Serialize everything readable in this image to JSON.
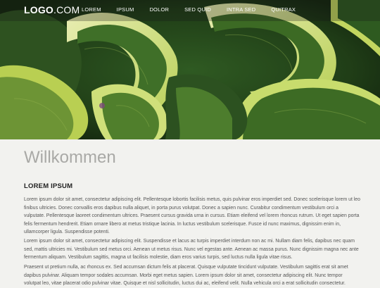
{
  "header": {
    "logo_bold": "LOGO",
    "logo_light": ".COM",
    "nav": [
      "LOREM",
      "IPSUM",
      "DOLOR",
      "SED QUID",
      "INTRA SED",
      "QUITRAX"
    ]
  },
  "colors": {
    "page_background": "#f2f2ef",
    "heading_color": "#a9a9a6",
    "leaf_dark": "#28461d",
    "leaf_light": "#cddc6e"
  },
  "main": {
    "title": "Willkommen",
    "section_heading": "LOREM IPSUM",
    "paragraphs": [
      "Lorem ipsum dolor sit amet, consectetur adipiscing elit. Pellentesque lobortis facilisis metus, quis pulvinar eros imperdiet sed. Donec scelerisque lorem ut leo finibus ultricies. Donec convallis eros dapibus nulla aliquet, in porta purus volutpat. Donec a sapien nunc. Curabitur condimentum vestibulum orci a vulputate. Pellentesque laoreet condimentum ultrices. Praesent cursus gravida urna in cursus. Etiam eleifend vel lorem rhoncus rutrum. Ut eget sapien porta felis fermentum hendrerit. Etiam ornare libero at metus tristique lacinia. In luctus vestibulum scelerisque. Fusce id nunc maximus, dignissim enim in, ullamcorper ligula. Suspendisse potenti.",
      "Lorem ipsum dolor sit amet, consectetur adipiscing elit. Suspendisse et lacus ac turpis imperdiet interdum non ac mi. Nullam diam felis, dapibus nec quam sed, mattis ultricies mi. Vestibulum sed metus orci. Aenean ut metus risus. Nunc vel egestas ante. Aenean ac massa purus. Nunc dignissim magna nec ante fermentum aliquam. Vestibulum sagittis, magna ut facilisis molestie, diam eros varius turpis, sed luctus nulla ligula vitae risus.",
      "Praesent ut pretium nulla, ac rhoncus ex. Sed accumsan dictum felis at placerat. Quisque vulputate tincidunt vulputate. Vestibulum sagittis erat sit amet dapibus pulvinar. Aliquam tempor sodales accumsan. Morbi eget metus sapien. Lorem ipsum dolor sit amet, consectetur adipiscing elit. Nunc tempor volutpat leo, vitae placerat odio pulvinar vitae. Quisque et nisl sollicitudin, luctus dui ac, eleifend velit. Nulla vehicula orci a erat sollicitudin consectetur."
    ]
  }
}
